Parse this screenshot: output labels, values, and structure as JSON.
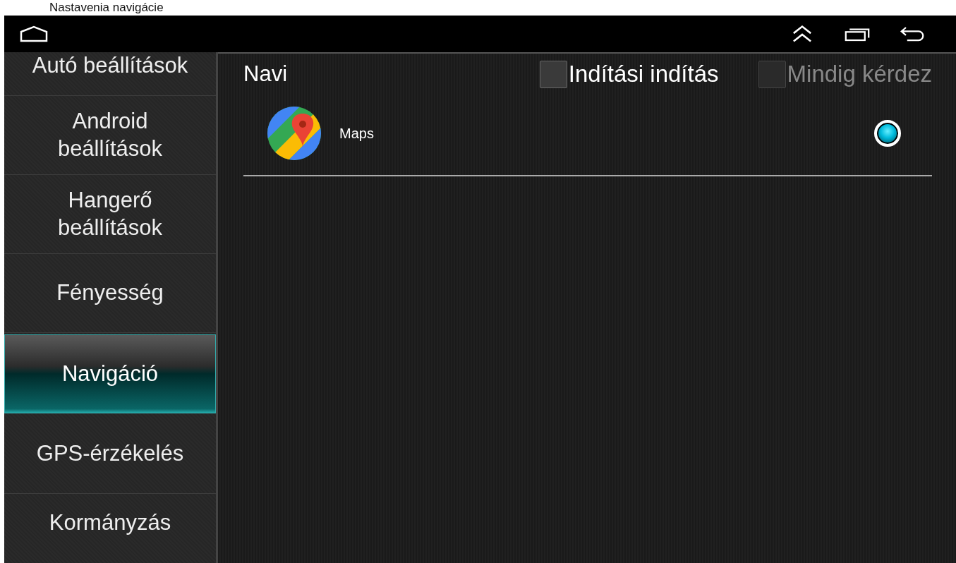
{
  "caption": "Nastavenia navigácie",
  "nav_bar": {
    "buttons": [
      {
        "kind": "home"
      },
      {
        "kind": "expand"
      },
      {
        "kind": "recents"
      },
      {
        "kind": "back"
      }
    ]
  },
  "sidebar": {
    "items": [
      {
        "label": "Autó beállítások",
        "selected": false
      },
      {
        "label": "Android beállítások",
        "selected": false
      },
      {
        "label": "Hangerő beállítások",
        "selected": false
      },
      {
        "label": "Fényesség",
        "selected": false
      },
      {
        "label": "Navigáció",
        "selected": true
      },
      {
        "label": "GPS-érzékelés",
        "selected": false
      },
      {
        "label": "Kormányzás",
        "selected": false
      }
    ]
  },
  "panel": {
    "title": "Navi",
    "options": [
      {
        "label": "Indítási indítás",
        "checked": false,
        "disabled": false
      },
      {
        "label": "Mindig kérdez",
        "checked": false,
        "disabled": true
      }
    ],
    "apps": [
      {
        "name": "Maps",
        "selected": true
      }
    ]
  }
}
